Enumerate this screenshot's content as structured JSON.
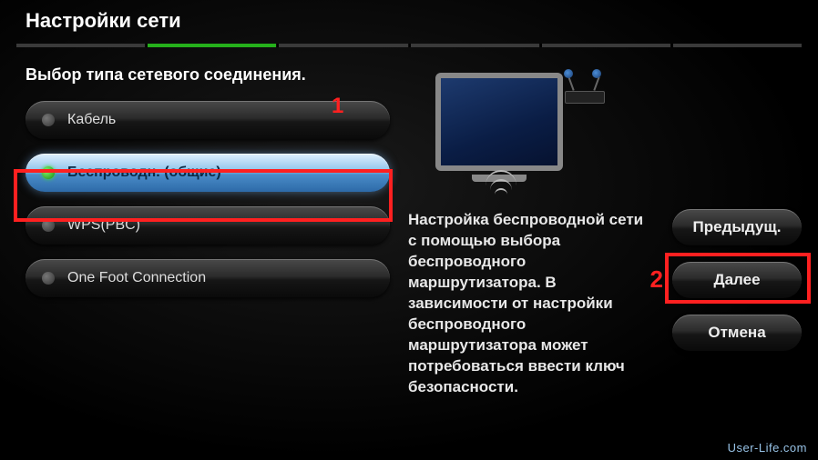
{
  "header": {
    "title": "Настройки сети"
  },
  "subtitle": "Выбор типа сетевого соединения.",
  "options": [
    {
      "label": "Кабель",
      "selected": false
    },
    {
      "label": "Беспроводн. (общие)",
      "selected": true
    },
    {
      "label": "WPS(PBC)",
      "selected": false
    },
    {
      "label": "One Foot Connection",
      "selected": false
    }
  ],
  "description": "Настройка беспроводной сети с помощью выбора беспроводного маршрутизатора. В зависимости от настройки беспроводного маршрутизатора может потребоваться ввести ключ безопасности.",
  "actions": {
    "previous": "Предыдущ.",
    "next": "Далее",
    "cancel": "Отмена"
  },
  "annotations": {
    "marker1": "1",
    "marker2": "2"
  },
  "watermark": "User-Life.com"
}
